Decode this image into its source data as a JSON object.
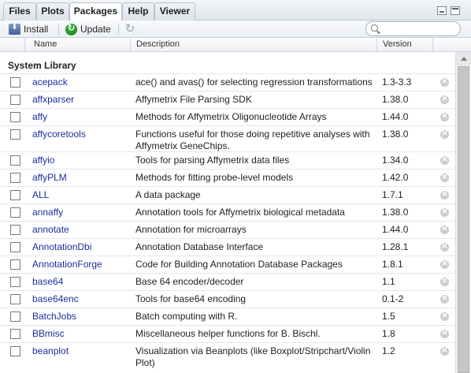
{
  "tabs": [
    {
      "label": "Files",
      "active": false
    },
    {
      "label": "Plots",
      "active": false
    },
    {
      "label": "Packages",
      "active": true
    },
    {
      "label": "Help",
      "active": false
    },
    {
      "label": "Viewer",
      "active": false
    }
  ],
  "toolbar": {
    "install_label": "Install",
    "update_label": "Update",
    "search_placeholder": ""
  },
  "columns": {
    "name": "Name",
    "description": "Description",
    "version": "Version"
  },
  "section_title": "System Library",
  "packages": [
    {
      "name": "acepack",
      "description": "ace() and avas() for selecting regression transformations",
      "version": "1.3-3.3",
      "checked": false
    },
    {
      "name": "affxparser",
      "description": "Affymetrix File Parsing SDK",
      "version": "1.38.0",
      "checked": false
    },
    {
      "name": "affy",
      "description": "Methods for Affymetrix Oligonucleotide Arrays",
      "version": "1.44.0",
      "checked": false
    },
    {
      "name": "affycoretools",
      "description": "Functions useful for those doing repetitive analyses with Affymetrix GeneChips.",
      "version": "1.38.0",
      "checked": false
    },
    {
      "name": "affyio",
      "description": "Tools for parsing Affymetrix data files",
      "version": "1.34.0",
      "checked": false
    },
    {
      "name": "affyPLM",
      "description": "Methods for fitting probe-level models",
      "version": "1.42.0",
      "checked": false
    },
    {
      "name": "ALL",
      "description": "A data package",
      "version": "1.7.1",
      "checked": false
    },
    {
      "name": "annaffy",
      "description": "Annotation tools for Affymetrix biological metadata",
      "version": "1.38.0",
      "checked": false
    },
    {
      "name": "annotate",
      "description": "Annotation for microarrays",
      "version": "1.44.0",
      "checked": false
    },
    {
      "name": "AnnotationDbi",
      "description": "Annotation Database Interface",
      "version": "1.28.1",
      "checked": false
    },
    {
      "name": "AnnotationForge",
      "description": "Code for Building Annotation Database Packages",
      "version": "1.8.1",
      "checked": false
    },
    {
      "name": "base64",
      "description": "Base 64 encoder/decoder",
      "version": "1.1",
      "checked": false
    },
    {
      "name": "base64enc",
      "description": "Tools for base64 encoding",
      "version": "0.1-2",
      "checked": false
    },
    {
      "name": "BatchJobs",
      "description": "Batch computing with R.",
      "version": "1.5",
      "checked": false
    },
    {
      "name": "BBmisc",
      "description": "Miscellaneous helper functions for B. Bischl.",
      "version": "1.8",
      "checked": false
    },
    {
      "name": "beanplot",
      "description": "Visualization via Beanplots (like Boxplot/Stripchart/Violin Plot)",
      "version": "1.2",
      "checked": false
    }
  ]
}
